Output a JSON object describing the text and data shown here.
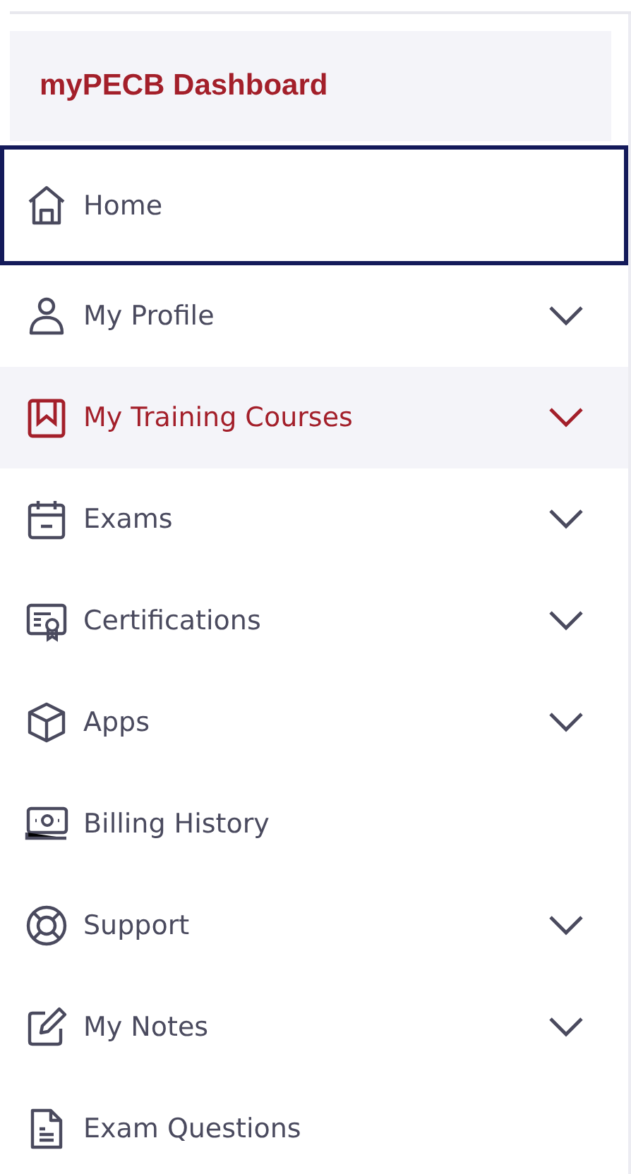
{
  "sidebar": {
    "title": "myPECB Dashboard",
    "items": [
      {
        "label": "Home",
        "selected": false,
        "focused": true,
        "expandable": false
      },
      {
        "label": "My Profile",
        "selected": false,
        "focused": false,
        "expandable": true
      },
      {
        "label": "My Training Courses",
        "selected": true,
        "focused": false,
        "expandable": true
      },
      {
        "label": "Exams",
        "selected": false,
        "focused": false,
        "expandable": true
      },
      {
        "label": "Certifications",
        "selected": false,
        "focused": false,
        "expandable": true
      },
      {
        "label": "Apps",
        "selected": false,
        "focused": false,
        "expandable": true
      },
      {
        "label": "Billing History",
        "selected": false,
        "focused": false,
        "expandable": false
      },
      {
        "label": "Support",
        "selected": false,
        "focused": false,
        "expandable": true
      },
      {
        "label": "My Notes",
        "selected": false,
        "focused": false,
        "expandable": true
      },
      {
        "label": "Exam Questions",
        "selected": false,
        "focused": false,
        "expandable": false
      }
    ]
  }
}
